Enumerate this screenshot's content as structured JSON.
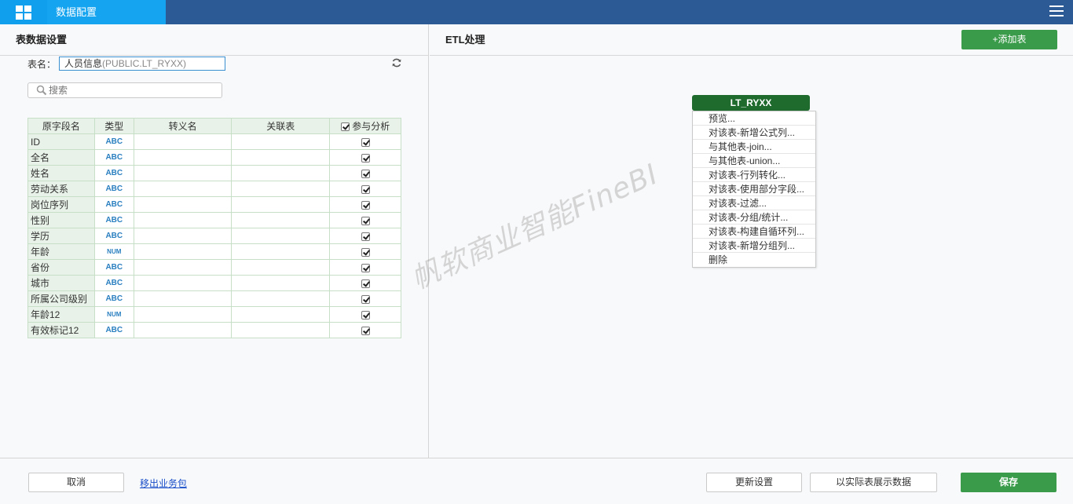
{
  "header": {
    "title": "数据配置",
    "home_icon": "grid-icon",
    "menu_icon": "hamburger-icon"
  },
  "left_panel": {
    "title": "表数据设置",
    "table_name_label": "表名：",
    "table_name_value": "人员信息",
    "table_name_source": "(PUBLIC.LT_RYXX)",
    "search_placeholder": "搜索",
    "columns": [
      "原字段名",
      "类型",
      "转义名",
      "关联表",
      "参与分析"
    ],
    "rows": [
      {
        "name": "ID",
        "type": "ABC",
        "checked": true
      },
      {
        "name": "全名",
        "type": "ABC",
        "checked": true
      },
      {
        "name": "姓名",
        "type": "ABC",
        "checked": true
      },
      {
        "name": "劳动关系",
        "type": "ABC",
        "checked": true
      },
      {
        "name": "岗位序列",
        "type": "ABC",
        "checked": true
      },
      {
        "name": "性别",
        "type": "ABC",
        "checked": true
      },
      {
        "name": "学历",
        "type": "ABC",
        "checked": true
      },
      {
        "name": "年龄",
        "type": "NUM",
        "checked": true
      },
      {
        "name": "省份",
        "type": "ABC",
        "checked": true
      },
      {
        "name": "城市",
        "type": "ABC",
        "checked": true
      },
      {
        "name": "所属公司级别",
        "type": "ABC",
        "checked": true
      },
      {
        "name": "年龄12",
        "type": "NUM",
        "checked": true
      },
      {
        "name": "有效标记12",
        "type": "ABC",
        "checked": true
      }
    ]
  },
  "right_panel": {
    "title": "ETL处理",
    "add_table_label": "+添加表",
    "node_label": "LT_RYXX",
    "menu_items": [
      "预览...",
      "对该表-新增公式列...",
      "与其他表-join...",
      "与其他表-union...",
      "对该表-行列转化...",
      "对该表-使用部分字段...",
      "对该表-过滤...",
      "对该表-分组/统计...",
      "对该表-构建自循环列...",
      "对该表-新增分组列...",
      "删除"
    ],
    "watermark": "帆软商业智能FineBI"
  },
  "footer": {
    "cancel_label": "取消",
    "remove_link": "移出业务包",
    "update_label": "更新设置",
    "show_real_label": "以实际表展示数据",
    "save_label": "保存"
  },
  "colors": {
    "topbar": "#2b5a95",
    "tab_active": "#15a4ef",
    "green": "#3a9b4a",
    "node_green": "#1f6b2e"
  }
}
